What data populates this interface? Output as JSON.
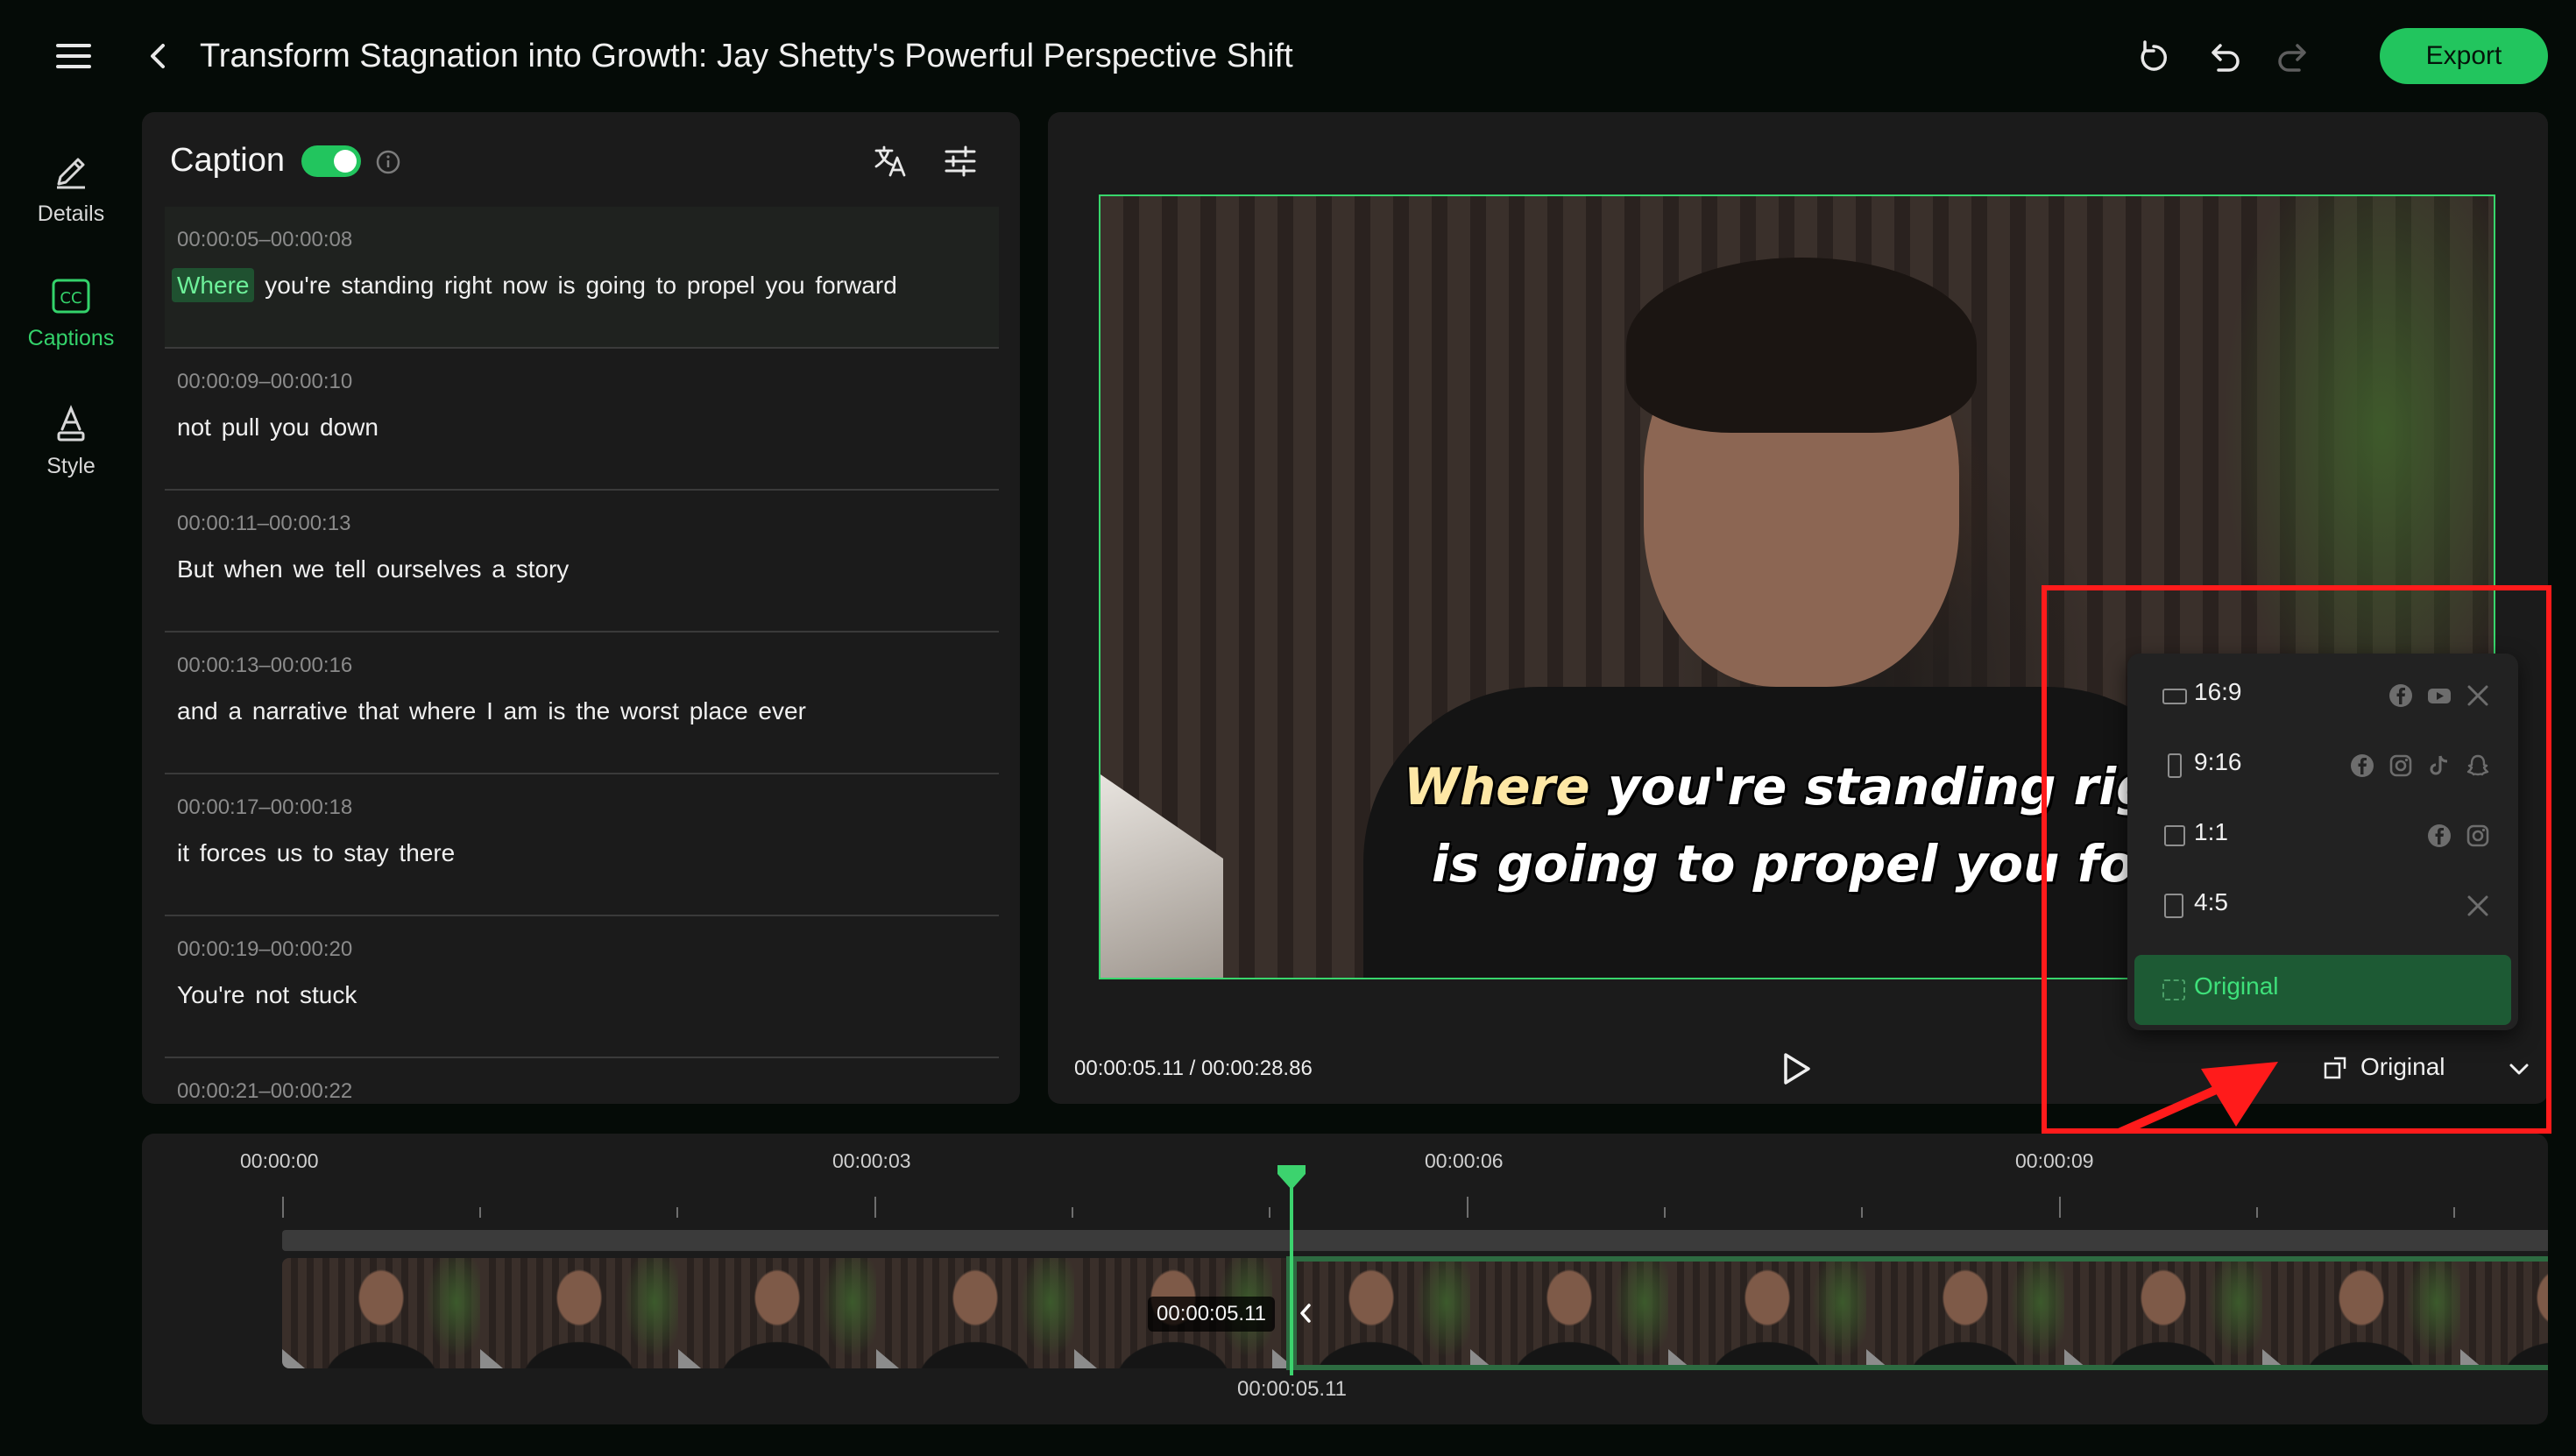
{
  "header": {
    "title": "Transform Stagnation into Growth: Jay Shetty's Powerful Perspective Shift",
    "export_label": "Export"
  },
  "sidebar": {
    "items": [
      {
        "label": "Details",
        "icon": "pencil-icon"
      },
      {
        "label": "Captions",
        "icon": "cc-icon",
        "active": true
      },
      {
        "label": "Style",
        "icon": "text-style-icon"
      }
    ]
  },
  "caption_panel": {
    "heading": "Caption",
    "toggle_on": true,
    "rows": [
      {
        "time": "00:00:05–00:00:08",
        "highlight": "Where",
        "text": " you're standing right now is going to propel you forward",
        "active": true
      },
      {
        "time": "00:00:09–00:00:10",
        "text": "not pull you down"
      },
      {
        "time": "00:00:11–00:00:13",
        "text": "But when we tell ourselves a story"
      },
      {
        "time": "00:00:13–00:00:16",
        "text": "and a narrative that where I am is the worst place ever"
      },
      {
        "time": "00:00:17–00:00:18",
        "text": "it forces us to stay there"
      },
      {
        "time": "00:00:19–00:00:20",
        "text": "You're not stuck"
      },
      {
        "time": "00:00:21–00:00:22",
        "text": ""
      }
    ]
  },
  "preview": {
    "subtitle_line1_highlight": "Where",
    "subtitle_line1_rest": " you're standing right no",
    "subtitle_line2": "is going to propel you forwar",
    "time_readout": "00:00:05.11 / 00:00:28.86",
    "aspect_label": "Original"
  },
  "aspect_menu": {
    "items": [
      {
        "label": "16:9",
        "icons": [
          "facebook-icon",
          "youtube-icon",
          "x-icon"
        ]
      },
      {
        "label": "9:16",
        "icons": [
          "facebook-icon",
          "instagram-icon",
          "tiktok-icon",
          "snapchat-icon"
        ]
      },
      {
        "label": "1:1",
        "icons": [
          "facebook-icon",
          "instagram-icon"
        ]
      },
      {
        "label": "4:5",
        "icons": [
          "x-icon"
        ]
      },
      {
        "label": "Original",
        "icons": [],
        "selected": true
      }
    ]
  },
  "timeline": {
    "ticks": [
      "00:00:00",
      "00:00:03",
      "00:00:06",
      "00:00:09"
    ],
    "clip_time": "00:00:05.11",
    "playhead_time": "00:00:05.11"
  },
  "colors": {
    "accent": "#22c55e",
    "annotation": "#ff1b1b",
    "background": "#050b07",
    "panel": "#1b1b1b"
  }
}
